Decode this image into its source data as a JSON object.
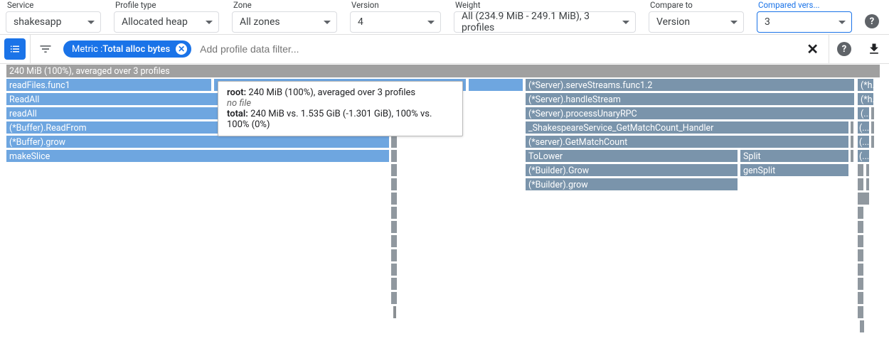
{
  "filters": {
    "service": {
      "label": "Service",
      "value": "shakesapp"
    },
    "profile_type": {
      "label": "Profile type",
      "value": "Allocated heap"
    },
    "zone": {
      "label": "Zone",
      "value": "All zones"
    },
    "version": {
      "label": "Version",
      "value": "4"
    },
    "weight": {
      "label": "Weight",
      "value": "All (234.9 MiB - 249.1 MiB), 3 profiles"
    },
    "compare_to": {
      "label": "Compare to",
      "value": "Version"
    },
    "compared_vers": {
      "label": "Compared vers...",
      "value": "3"
    }
  },
  "toolbar": {
    "metric_prefix": "Metric : ",
    "metric_value": "Total alloc bytes",
    "filter_placeholder": "Add profile data filter..."
  },
  "root_label": "240 MiB (100%), averaged over 3 profiles",
  "tooltip": {
    "line1_prefix": "root: ",
    "line1_rest": "240 MiB (100%), averaged over 3 profiles",
    "nofile": "no file",
    "total_prefix": "total: ",
    "total_rest": "240 MiB vs. 1.535 GiB (-1.301 GiB), 100% vs. 100% (0%)"
  },
  "left_stack": {
    "readFiles_func1": "readFiles.func1",
    "ReadAll": "ReadAll",
    "readAll": "readAll",
    "Buffer_ReadFrom": "(*Buffer).ReadFrom",
    "Buffer_grow": "(*Buffer).grow",
    "makeSlice": "makeSlice"
  },
  "right_stack": {
    "serveStreams": "(*Server).serveStreams.func1.2",
    "handleStream": "(*Server).handleStream",
    "processUnary": "(*Server).processUnaryRPC",
    "handler": "_ShakespeareService_GetMatchCount_Handler",
    "getMatch": "(*server).GetMatchCount",
    "ToLower": "ToLower",
    "Split": "Split",
    "genSplit": "genSplit",
    "Builder_Grow": "(*Builder).Grow",
    "Builder_grow": "(*Builder).grow",
    "star_h": "(*h...",
    "star_h2": "(*h...",
    "ellipsis": "(...",
    "ellipsis2": "(...",
    "ellipsis3": "(..."
  }
}
